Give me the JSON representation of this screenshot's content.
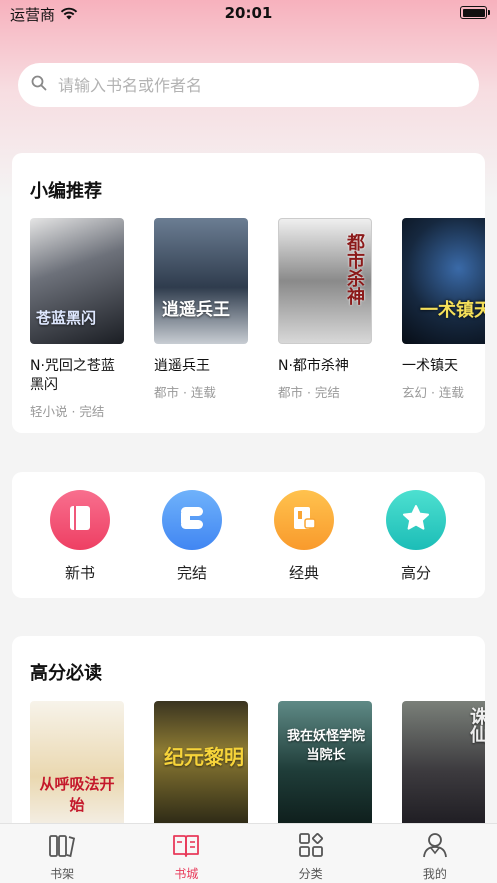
{
  "status_bar": {
    "carrier": "运营商",
    "time": "20:01"
  },
  "search": {
    "placeholder": "请输入书名或作者名"
  },
  "recommend": {
    "title": "小编推荐",
    "books": [
      {
        "title": "N·咒回之苍蓝黑闪",
        "meta": "轻小说 · 完结",
        "cover_text": "苍蓝黑闪",
        "cover_colors": [
          "#2a2e35",
          "#7a7f88"
        ]
      },
      {
        "title": "逍遥兵王",
        "meta": "都市 · 连载",
        "cover_text": "逍遥兵王",
        "cover_colors": [
          "#3d4a5c",
          "#a9b4c0"
        ]
      },
      {
        "title": "N·都市杀神",
        "meta": "都市 · 完结",
        "cover_text": "都市杀神",
        "cover_colors": [
          "#d9d9d9",
          "#5b5b5b"
        ]
      },
      {
        "title": "一术镇天",
        "meta": "玄幻 · 连载",
        "cover_text": "一术镇天",
        "cover_colors": [
          "#0b1422",
          "#2f4f7a"
        ]
      }
    ]
  },
  "categories": [
    {
      "label": "新书",
      "icon": "book-icon",
      "colors": [
        "#f86f8e",
        "#ee3f63"
      ]
    },
    {
      "label": "完结",
      "icon": "completed-icon",
      "colors": [
        "#6fb2fb",
        "#4186f2"
      ]
    },
    {
      "label": "经典",
      "icon": "classic-icon",
      "colors": [
        "#ffc24e",
        "#f99a2c"
      ]
    },
    {
      "label": "高分",
      "icon": "star-icon",
      "colors": [
        "#4de0d0",
        "#1cbdb7"
      ]
    }
  ],
  "high_score": {
    "title": "高分必读",
    "books": [
      {
        "cover_text": "从呼吸法开始",
        "cover_colors": [
          "#f5f1ea",
          "#d9c9a6"
        ]
      },
      {
        "cover_text": "纪元黎明",
        "cover_colors": [
          "#2d2a1a",
          "#d6b233"
        ]
      },
      {
        "cover_text": "我在妖怪学院当院长",
        "cover_colors": [
          "#1d3a35",
          "#6c8f7a"
        ]
      },
      {
        "cover_text": "诛仙",
        "cover_colors": [
          "#2a2c33",
          "#8a8f8a"
        ]
      }
    ]
  },
  "tabbar": {
    "tabs": [
      {
        "label": "书架",
        "icon": "bookshelf-icon",
        "active": false
      },
      {
        "label": "书城",
        "icon": "bookstore-icon",
        "active": true
      },
      {
        "label": "分类",
        "icon": "category-icon",
        "active": false
      },
      {
        "label": "我的",
        "icon": "profile-icon",
        "active": false
      }
    ]
  },
  "colors": {
    "accent": "#e83a5a",
    "background": "#f4f4f4"
  }
}
